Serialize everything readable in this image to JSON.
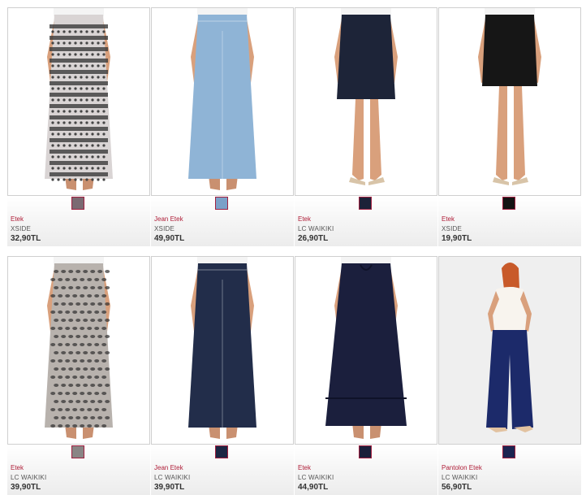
{
  "products": [
    {
      "category": "Etek",
      "brand": "XSIDE",
      "price": "32,90TL",
      "swatch": "#7b6a72",
      "skirt": "#d9d4d4",
      "pattern": "print-bw",
      "length": "maxi"
    },
    {
      "category": "Jean Etek",
      "brand": "XSIDE",
      "price": "49,90TL",
      "swatch": "#7aa0c8",
      "skirt": "#8fb4d6",
      "pattern": "denim-light",
      "length": "maxi"
    },
    {
      "category": "Etek",
      "brand": "LC WAIKIKI",
      "price": "26,90TL",
      "swatch": "#1c2238",
      "skirt": "#1d2438",
      "pattern": "solid",
      "length": "knee"
    },
    {
      "category": "Etek",
      "brand": "XSIDE",
      "price": "19,90TL",
      "swatch": "#141414",
      "skirt": "#161616",
      "pattern": "solid",
      "length": "mini"
    },
    {
      "category": "Etek",
      "brand": "LC WAIKIKI",
      "price": "39,90TL",
      "swatch": "#8a8585",
      "skirt": "#b8b2ad",
      "pattern": "animal",
      "length": "maxi"
    },
    {
      "category": "Jean Etek",
      "brand": "LC WAIKIKI",
      "price": "39,90TL",
      "swatch": "#1d2744",
      "skirt": "#222d4a",
      "pattern": "denim-dark",
      "length": "maxi"
    },
    {
      "category": "Etek",
      "brand": "LC WAIKIKI",
      "price": "44,90TL",
      "swatch": "#1a1f3a",
      "skirt": "#1b1f3d",
      "pattern": "solid",
      "length": "maxi-flare"
    },
    {
      "category": "Pantolon Etek",
      "brand": "LC WAIKIKI",
      "price": "56,90TL",
      "swatch": "#1b2450",
      "skirt": "#1c2a6a",
      "pattern": "wide-leg",
      "length": "full"
    }
  ]
}
